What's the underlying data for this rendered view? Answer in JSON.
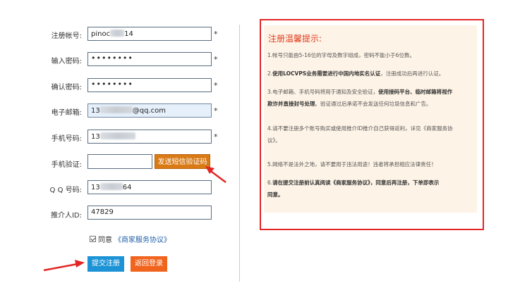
{
  "form": {
    "username": {
      "label": "注册帐号:",
      "value_start": "pinoc",
      "value_end": "14"
    },
    "password": {
      "label": "输入密码:",
      "value": "••••••••"
    },
    "confirm": {
      "label": "确认密码:",
      "value": "••••••••"
    },
    "email": {
      "label": "电子邮箱:",
      "value_start": "13",
      "value_end": "@qq.com"
    },
    "phone": {
      "label": "手机号码:",
      "value_start": "13"
    },
    "sms": {
      "label": "手机验证:",
      "value": "",
      "button": "发送短信验证码"
    },
    "qq": {
      "label": "Q Q 号码:",
      "value_start": "13",
      "value_end": "64"
    },
    "referrer": {
      "label": "推介人ID:",
      "value": "47829"
    },
    "required_mark": "*",
    "agree": {
      "prefix": "同意",
      "link": "《商家服务协议》",
      "checked": true
    },
    "submit": "提交注册",
    "back": "返回登录"
  },
  "tips": {
    "title": "注册温馨提示:",
    "items": [
      {
        "num": "1.",
        "text": "帐号只能由5-16位的字母及数字组成，密码不能小于6位数。"
      },
      {
        "num": "2.",
        "bold": "使用LOCVPS业务需要进行中国内地实名认证",
        "text": "，注册成功后再进行认证。"
      },
      {
        "num": "3.",
        "text": "电子邮箱、手机号码将用于通知及安全验证，",
        "bold": "使用接码平台、临时邮箱将视作",
        "bold2": "欺诈并直接封号处理",
        "text2": "。验证通过后承诺不会发送任何垃圾信息和广告。"
      },
      {
        "num": "4.",
        "text": "请不要注册多个账号购买或使用推介ID推介自己获得返利，详见《商家服务协",
        "text2": "议》。"
      },
      {
        "num": "5.",
        "text": "网络不是法外之地，请不要用于违法用途！违者将承担相应法律责任！"
      },
      {
        "num": "6.",
        "bold": "请在提交注册前认真阅读《商家服务协议》，同意后再注册，下单即表示",
        "bold2": "同意。"
      }
    ]
  },
  "colors": {
    "sms_button": "#d97a14",
    "submit_button": "#1b93d6",
    "back_button": "#f0641e",
    "tips_border": "#e32525",
    "tips_title": "#e03c1e",
    "annotation_arrow": "#e32525"
  }
}
